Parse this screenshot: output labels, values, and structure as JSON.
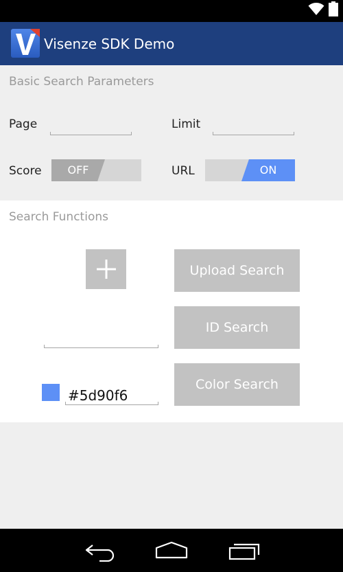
{
  "app": {
    "title": "Visenze SDK Demo",
    "logo_letter": "V"
  },
  "status_bar": {
    "icons": [
      "wifi-icon",
      "battery-icon"
    ]
  },
  "basic_params": {
    "section_title": "Basic Search Parameters",
    "page_label": "Page",
    "page_value": "",
    "limit_label": "Limit",
    "limit_value": "",
    "score_label": "Score",
    "score_toggle": {
      "state": "OFF",
      "text": "OFF"
    },
    "url_label": "URL",
    "url_toggle": {
      "state": "ON",
      "text": "ON"
    }
  },
  "search_functions": {
    "section_title": "Search Functions",
    "add_image_icon": "plus-icon",
    "upload_button": "Upload Search",
    "id_search_value": "",
    "id_button": "ID Search",
    "color_value": "#5d90f6",
    "color_swatch": "#5d90f6",
    "color_button": "Color Search"
  },
  "nav_bar": {
    "icons": [
      "back-icon",
      "home-icon",
      "recents-icon"
    ]
  },
  "colors": {
    "action_bar": "#1e3f7e",
    "accent": "#5d90f6",
    "toggle_off": "#a9a9a9",
    "button_bg": "#c2c2c2"
  }
}
